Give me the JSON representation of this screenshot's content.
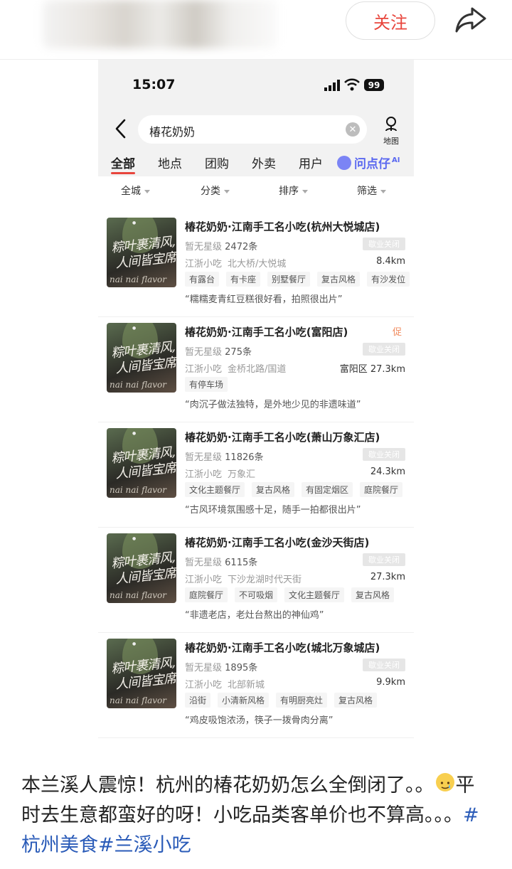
{
  "header": {
    "follow_label": "关注",
    "share_icon": "share-icon"
  },
  "phone": {
    "status": {
      "time": "15:07",
      "battery": "99"
    },
    "search": {
      "query": "椿花奶奶",
      "map_label": "地图"
    },
    "tabs": [
      "全部",
      "地点",
      "团购",
      "外卖",
      "用户"
    ],
    "ai_tab": {
      "label": "问点仔",
      "sup": "AI"
    },
    "filters": [
      "全城",
      "分类",
      "排序",
      "筛选"
    ],
    "items": [
      {
        "name": "椿花奶奶·江南手工名小吃(杭州大悦城店)",
        "rating_label": "暂无星级",
        "reviews": "2472条",
        "status": "歇业关闭",
        "category": "江浙小吃",
        "area": "北大桥/大悦城",
        "distance": "8.4km",
        "tags": [
          "有露台",
          "有卡座",
          "别墅餐厅",
          "复古风格",
          "有沙发位"
        ],
        "quote": "“糯糯麦青红豆糕很好看，拍照很出片”",
        "promo": ""
      },
      {
        "name": "椿花奶奶·江南手工名小吃(富阳店)",
        "rating_label": "暂无星级",
        "reviews": "275条",
        "status": "歇业关闭",
        "category": "江浙小吃",
        "area": "金桥北路/国道",
        "distance": "富阳区 27.3km",
        "tags": [
          "有停车场"
        ],
        "quote": "“肉沉子做法独特，是外地少见的非遗味道”",
        "promo": "促"
      },
      {
        "name": "椿花奶奶·江南手工名小吃(萧山万象汇店)",
        "rating_label": "暂无星级",
        "reviews": "11826条",
        "status": "歇业关闭",
        "category": "江浙小吃",
        "area": "万象汇",
        "distance": "24.3km",
        "tags": [
          "文化主题餐厅",
          "复古风格",
          "有固定烟区",
          "庭院餐厅"
        ],
        "quote": "“古风环境氛围感十足，随手一拍都很出片”",
        "promo": ""
      },
      {
        "name": "椿花奶奶·江南手工名小吃(金沙天街店)",
        "rating_label": "暂无星级",
        "reviews": "6115条",
        "status": "歇业关闭",
        "category": "江浙小吃",
        "area": "下沙龙湖时代天街",
        "distance": "27.3km",
        "tags": [
          "庭院餐厅",
          "不可吸烟",
          "文化主题餐厅",
          "复古风格"
        ],
        "quote": "“非遗老店，老灶台熬出的神仙鸡”",
        "promo": ""
      },
      {
        "name": "椿花奶奶·江南手工名小吃(城北万象城店)",
        "rating_label": "暂无星级",
        "reviews": "1895条",
        "status": "歇业关闭",
        "category": "江浙小吃",
        "area": "北部新城",
        "distance": "9.9km",
        "tags": [
          "沿街",
          "小清新风格",
          "有明厨亮灶",
          "复古风格"
        ],
        "quote": "“鸡皮吸饱浓汤，筷子一拨骨肉分离”",
        "promo": ""
      }
    ],
    "thumb": {
      "line1": "粽叶裹清风,",
      "line2": "人间皆宝席",
      "flavor": "nai nai flavor"
    }
  },
  "post": {
    "text_a": "本兰溪人震惊！杭州的椿花奶奶怎么全倒闭了。。",
    "emoji": "smiling-face-with-tear-icon",
    "text_b": "平时去生意都蛮好的呀！小吃品类客单价也不算高。。。",
    "hashtag1": "#杭州美食",
    "hashtag2": "#兰溪小吃"
  }
}
